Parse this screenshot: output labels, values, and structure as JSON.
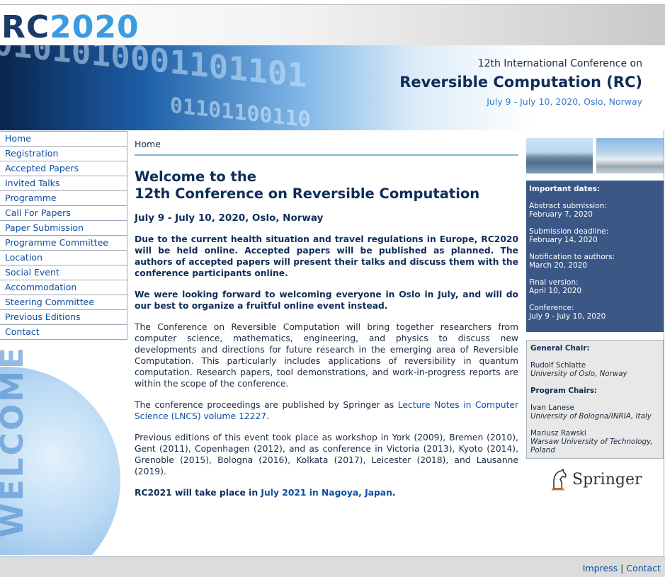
{
  "logo": {
    "rc": "RC",
    "year": "2020"
  },
  "banner": {
    "subtitle": "12th International Conference on",
    "title": "Reversible Computation (RC)",
    "date": "July 9 - July 10, 2020, Oslo, Norway",
    "digits1": "0101010001101101",
    "digits2": "01101100110"
  },
  "nav": [
    "Home",
    "Registration",
    "Accepted Papers",
    "Invited Talks",
    "Programme",
    "Call For Papers",
    "Paper Submission",
    "Programme Committee",
    "Location",
    "Social Event",
    "Accommodation",
    "Steering Committee",
    "Previous Editions",
    "Contact"
  ],
  "globe": {
    "word": "WELCOME"
  },
  "main": {
    "breadcrumb": "Home",
    "heading_line1": "Welcome to the",
    "heading_line2": "12th Conference on Reversible Computation",
    "date_line": "July 9 - July 10, 2020, Oslo, Norway",
    "p1": "Due to the current health situation and travel regulations in Europe, RC2020 will be held online. Accepted papers will be published as planned. The authors of accepted papers will present their talks and discuss them with the conference participants online.",
    "p2": "We were looking forward to welcoming everyone in Oslo in July, and will do our best to organize a fruitful online event instead.",
    "p3": "The Conference on Reversible Computation will bring together researchers from computer science, mathematics, engineering, and physics to discuss new developments and directions for future research in the emerging area of Reversible Computation. This particularly includes applications of reversibility in quantum computation. Research papers, tool demonstrations, and work-in-progress reports are within the scope of the conference.",
    "p4_text": "The conference proceedings are published by Springer as ",
    "p4_link": "Lecture Notes in Computer Science (LNCS) volume 12227",
    "p4_end": ".",
    "p5": "Previous editions of this event took place as workshop in York (2009), Bremen (2010), Gent (2011), Copenhagen (2012), and as conference in Victoria (2013), Kyoto (2014), Grenoble (2015), Bologna (2016), Kolkata (2017), Leicester (2018), and Lausanne (2019).",
    "p6_text": "RC2021 will take place in ",
    "p6_link": "July 2021 in Nagoya, Japan",
    "p6_end": "."
  },
  "dates": {
    "heading": "Important dates:",
    "items": [
      {
        "label": "Abstract submission:",
        "value": "February 7, 2020"
      },
      {
        "label": "Submission deadline:",
        "value": "February 14, 2020"
      },
      {
        "label": "Notification to authors:",
        "value": "March 20, 2020"
      },
      {
        "label": "Final version:",
        "value": "April 10, 2020"
      },
      {
        "label": "Conference:",
        "value": "July 9 - July 10, 2020"
      }
    ]
  },
  "chairs": {
    "general_heading": "General Chair:",
    "general": [
      {
        "name": "Rudolf Schlatte",
        "aff": "University of Oslo, Norway"
      }
    ],
    "program_heading": "Program Chairs:",
    "program": [
      {
        "name": "Ivan Lanese",
        "aff": "University of Bologna/INRIA, Italy"
      },
      {
        "name": "Mariusz Rawski",
        "aff": "Warsaw University of Technology, Poland"
      }
    ]
  },
  "springer": {
    "word": "Springer"
  },
  "footer": {
    "impress": "Impress",
    "sep": "|",
    "contact": "Contact"
  }
}
